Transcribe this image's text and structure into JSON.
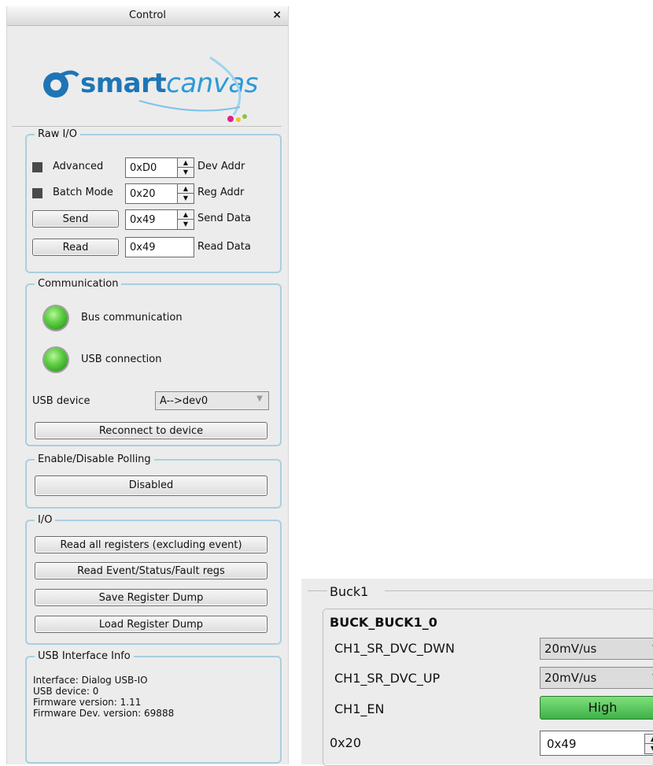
{
  "window": {
    "title": "Control",
    "close_glyph": "×"
  },
  "logo": {
    "part1": "smart",
    "part2": "canvas",
    "icon": "smartcanvas-logo-icon"
  },
  "raw_io": {
    "legend": "Raw I/O",
    "advanced_label": "Advanced",
    "batch_mode_label": "Batch Mode",
    "send_label": "Send",
    "read_label": "Read",
    "dev_addr_value": "0xD0",
    "dev_addr_label": "Dev Addr",
    "reg_addr_value": "0x20",
    "reg_addr_label": "Reg Addr",
    "send_data_value": "0x49",
    "send_data_label": "Send Data",
    "read_data_value": "0x49",
    "read_data_label": "Read Data"
  },
  "communication": {
    "legend": "Communication",
    "bus_label": "Bus communication",
    "usb_label": "USB connection",
    "usb_device_label": "USB device",
    "usb_device_value": "A-->dev0",
    "reconnect_label": "Reconnect to device",
    "led_color": "#4fc23a"
  },
  "polling": {
    "legend": "Enable/Disable Polling",
    "button_label": "Disabled"
  },
  "io": {
    "legend": "I/O",
    "buttons": [
      "Read all registers (excluding event)",
      "Read Event/Status/Fault regs",
      "Save Register Dump",
      "Load Register Dump"
    ]
  },
  "usb_info": {
    "legend": "USB Interface Info",
    "lines": [
      "Interface: Dialog USB-IO",
      "USB device: 0",
      "Firmware version: 1.11",
      "Firmware Dev. version: 69888"
    ]
  },
  "buck": {
    "legend": "Buck1",
    "register": "BUCK_BUCK1_0",
    "dwn_label": "CH1_SR_DVC_DWN",
    "dwn_value": "20mV/us",
    "up_label": "CH1_SR_DVC_UP",
    "up_value": "20mV/us",
    "en_label": "CH1_EN",
    "en_value": "High",
    "addr_label": "0x20",
    "addr_value": "0x49",
    "en_color": "#4cbb4f"
  }
}
